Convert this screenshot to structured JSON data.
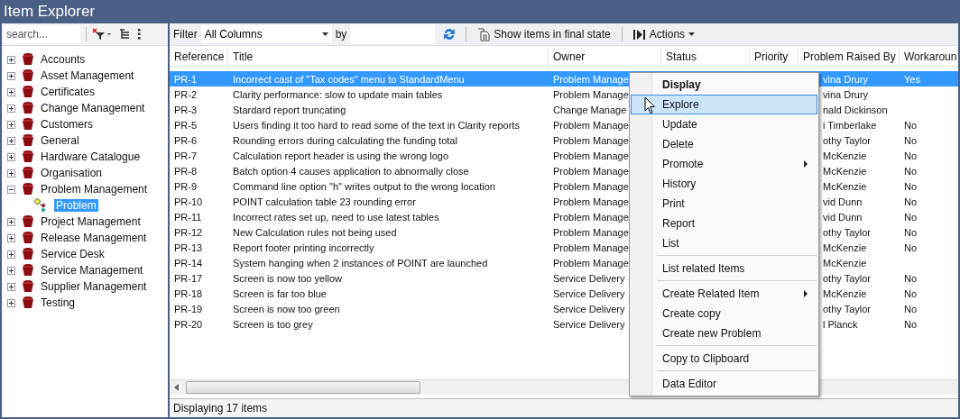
{
  "window": {
    "title": "Item Explorer"
  },
  "sidebar": {
    "search": {
      "placeholder": "search..."
    },
    "tree": [
      {
        "label": "Accounts",
        "expanded": false,
        "selected": false
      },
      {
        "label": "Asset Management",
        "expanded": false,
        "selected": false
      },
      {
        "label": "Certificates",
        "expanded": false,
        "selected": false
      },
      {
        "label": "Change Management",
        "expanded": false,
        "selected": false
      },
      {
        "label": "Customers",
        "expanded": false,
        "selected": false
      },
      {
        "label": "General",
        "expanded": false,
        "selected": false
      },
      {
        "label": "Hardware Catalogue",
        "expanded": false,
        "selected": false
      },
      {
        "label": "Organisation",
        "expanded": false,
        "selected": false
      },
      {
        "label": "Problem Management",
        "expanded": true,
        "selected": false,
        "children": [
          {
            "label": "Problem",
            "selected": true
          }
        ]
      },
      {
        "label": "Project Management",
        "expanded": false,
        "selected": false
      },
      {
        "label": "Release Management",
        "expanded": false,
        "selected": false
      },
      {
        "label": "Service Desk",
        "expanded": false,
        "selected": false
      },
      {
        "label": "Service Management",
        "expanded": false,
        "selected": false
      },
      {
        "label": "Supplier Management",
        "expanded": false,
        "selected": false
      },
      {
        "label": "Testing",
        "expanded": false,
        "selected": false
      }
    ]
  },
  "toolbar": {
    "filter_label": "Filter",
    "column_select": {
      "value": "All Columns"
    },
    "by_label": "by",
    "final_state_button": "Show items in final state",
    "actions_button": "Actions"
  },
  "table": {
    "columns": [
      "Reference",
      "Title",
      "Owner",
      "Status",
      "Priority",
      "Problem Raised By",
      "Workaroun"
    ],
    "rows": [
      {
        "reference": "PR-1",
        "title": "Incorrect cast of \"Tax codes\" menu to StandardMenu",
        "owner": "Problem Manage",
        "raised_by": "vina Drury",
        "workaround": "Yes",
        "selected": true
      },
      {
        "reference": "PR-2",
        "title": "Clarity performance: slow to update main tables",
        "owner": "Problem Manage",
        "raised_by": "vina Drury",
        "selected": false
      },
      {
        "reference": "PR-3",
        "title": "Stardard report truncating",
        "owner": "Change Manage",
        "raised_by": "nald Dickinson",
        "selected": false
      },
      {
        "reference": "PR-5",
        "title": "Users finding it too hard to read some of the text in Clarity reports",
        "owner": "Problem Manage",
        "raised_by": "i Timberlake",
        "workaround": "No",
        "selected": false
      },
      {
        "reference": "PR-6",
        "title": "Rounding errors during calculating the funding total",
        "owner": "Problem Manage",
        "raised_by": "othy Taylor",
        "workaround": "No",
        "selected": false
      },
      {
        "reference": "PR-7",
        "title": "Calculation report header is using the wrong logo",
        "owner": "Problem Manage",
        "raised_by": "McKenzie",
        "workaround": "No",
        "selected": false
      },
      {
        "reference": "PR-8",
        "title": "Batch option 4 causes application to abnormally close",
        "owner": "Problem Manage",
        "raised_by": "McKenzie",
        "workaround": "No",
        "selected": false
      },
      {
        "reference": "PR-9",
        "title": "Command line option \"h\" writes output to the wrong location",
        "owner": "Problem Manage",
        "raised_by": "McKenzie",
        "workaround": "No",
        "selected": false
      },
      {
        "reference": "PR-10",
        "title": "POINT calculation table 23 rounding error",
        "owner": "Problem Manage",
        "raised_by": "vid Dunn",
        "workaround": "No",
        "selected": false
      },
      {
        "reference": "PR-11",
        "title": "Incorrect rates set up, need to use latest tables",
        "owner": "Problem Manage",
        "raised_by": "vid Dunn",
        "workaround": "No",
        "selected": false
      },
      {
        "reference": "PR-12",
        "title": "New Calculation rules not being used",
        "owner": "Problem Manage",
        "raised_by": "othy Taylor",
        "workaround": "No",
        "selected": false
      },
      {
        "reference": "PR-13",
        "title": "Report footer printing incorrectly",
        "owner": "Problem Manage",
        "raised_by": "McKenzie",
        "workaround": "No",
        "selected": false
      },
      {
        "reference": "PR-14",
        "title": "System hanging when 2 instances of POINT are launched",
        "owner": "Problem Manage",
        "raised_by": "McKenzie",
        "selected": false
      },
      {
        "reference": "PR-17",
        "title": "Screen is now too yellow",
        "owner": "Service Delivery",
        "raised_by": "othy Taylor",
        "workaround": "No",
        "selected": false
      },
      {
        "reference": "PR-18",
        "title": "Screen is far too blue",
        "owner": "Service Delivery",
        "raised_by": "McKenzie",
        "workaround": "No",
        "selected": false
      },
      {
        "reference": "PR-19",
        "title": "Screen is now too green",
        "owner": "Service Delivery",
        "raised_by": "othy Taylor",
        "workaround": "No",
        "selected": false
      },
      {
        "reference": "PR-20",
        "title": "Screen is too grey",
        "owner": "Service Delivery",
        "raised_by": "l Planck",
        "workaround": "No",
        "selected": false
      }
    ]
  },
  "context_menu": {
    "items": [
      {
        "kind": "item",
        "label": "Display",
        "default": true,
        "selected": false,
        "submenu": false
      },
      {
        "kind": "item",
        "label": "Explore",
        "default": false,
        "selected": true,
        "submenu": false
      },
      {
        "kind": "item",
        "label": "Update",
        "default": false,
        "selected": false,
        "submenu": false
      },
      {
        "kind": "item",
        "label": "Delete",
        "default": false,
        "selected": false,
        "submenu": false
      },
      {
        "kind": "item",
        "label": "Promote",
        "default": false,
        "selected": false,
        "submenu": true
      },
      {
        "kind": "item",
        "label": "History",
        "default": false,
        "selected": false,
        "submenu": false
      },
      {
        "kind": "item",
        "label": "Print",
        "default": false,
        "selected": false,
        "submenu": false
      },
      {
        "kind": "item",
        "label": "Report",
        "default": false,
        "selected": false,
        "submenu": false
      },
      {
        "kind": "item",
        "label": "List",
        "default": false,
        "selected": false,
        "submenu": false
      },
      {
        "kind": "separator"
      },
      {
        "kind": "item",
        "label": "List related Items",
        "default": false,
        "selected": false,
        "submenu": false
      },
      {
        "kind": "separator"
      },
      {
        "kind": "item",
        "label": "Create Related Item",
        "default": false,
        "selected": false,
        "submenu": true
      },
      {
        "kind": "item",
        "label": "Create copy",
        "default": false,
        "selected": false,
        "submenu": false
      },
      {
        "kind": "item",
        "label": "Create new Problem",
        "default": false,
        "selected": false,
        "submenu": false
      },
      {
        "kind": "separator"
      },
      {
        "kind": "item",
        "label": "Copy to Clipboard",
        "default": false,
        "selected": false,
        "submenu": false
      },
      {
        "kind": "separator"
      },
      {
        "kind": "item",
        "label": "Data Editor",
        "default": false,
        "selected": false,
        "submenu": false
      }
    ]
  },
  "status_bar": {
    "text": "Displaying 17 items"
  }
}
